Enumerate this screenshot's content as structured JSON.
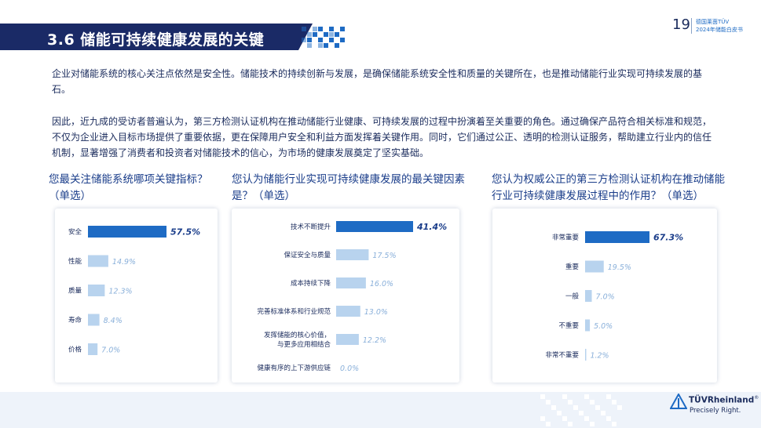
{
  "header": {
    "section_title": "3.6 储能可持续健康发展的关键",
    "page_number": "19",
    "brand_line1": "德国莱茵TÜV",
    "brand_line2": "2024年储能白皮书"
  },
  "body": {
    "paragraph1": "企业对储能系统的核心关注点依然是安全性。储能技术的持续创新与发展，是确保储能系统安全性和质量的关键所在，也是推动储能行业实现可持续发展的基石。",
    "paragraph2": "因此，近九成的受访者普遍认为，第三方检测认证机构在推动储能行业健康、可持续发展的过程中扮演着至关重要的角色。通过确保产品符合相关标准和规范，不仅为企业进入目标市场提供了重要依据，更在保障用户安全和利益方面发挥着关键作用。同时，它们通过公正、透明的检测认证服务，帮助建立行业内的信任机制，显著增强了消费者和投资者对储能技术的信心，为市场的健康发展奠定了坚实基础。"
  },
  "questions": {
    "q1": "您最关注储能系统哪项关键指标？（单选）",
    "q2": "您认为储能行业实现可持续健康发展的最关键因素是？（单选）",
    "q3": "您认为权威公正的第三方检测认证机构在推动储能行业可持续健康发展过程中的作用？（单选）"
  },
  "colors": {
    "highlight": "#1e6bc4",
    "bar": "#b8d3ee",
    "header": "#1a2a66",
    "value_highlight": "#1a3d8a",
    "value_normal": "#8ab0da"
  },
  "chart_data": [
    {
      "type": "bar",
      "orientation": "horizontal",
      "categories": [
        "安全",
        "性能",
        "质量",
        "寿命",
        "价格"
      ],
      "values": [
        57.5,
        14.9,
        12.3,
        8.4,
        7.0
      ],
      "value_labels": [
        "57.5%",
        "14.9%",
        "12.3%",
        "8.4%",
        "7.0%"
      ],
      "highlight_index": 0,
      "xlim": [
        0,
        57.5
      ]
    },
    {
      "type": "bar",
      "orientation": "horizontal",
      "categories": [
        "技术不断提升",
        "保证安全与质量",
        "成本持续下降",
        "完善标准体系和行业规范",
        "发挥储能的核心价值，与更多应用相结合",
        "健康有序的上下游供应链"
      ],
      "category_lines": [
        [
          "技术不断提升"
        ],
        [
          "保证安全与质量"
        ],
        [
          "成本持续下降"
        ],
        [
          "完善标准体系和行业规范"
        ],
        [
          "发挥储能的核心价值，",
          "与更多应用相结合"
        ],
        [
          "健康有序的上下游供应链"
        ]
      ],
      "values": [
        41.4,
        17.5,
        16.0,
        13.0,
        12.2,
        0.0
      ],
      "value_labels": [
        "41.4%",
        "17.5%",
        "16.0%",
        "13.0%",
        "12.2%",
        "0.0%"
      ],
      "highlight_index": 0,
      "xlim": [
        0,
        41.4
      ]
    },
    {
      "type": "bar",
      "orientation": "horizontal",
      "categories": [
        "非常重要",
        "重要",
        "一般",
        "不重要",
        "非常不重要"
      ],
      "values": [
        67.3,
        19.5,
        7.0,
        5.0,
        1.2
      ],
      "value_labels": [
        "67.3%",
        "19.5%",
        "7.0%",
        "5.0%",
        "1.2%"
      ],
      "highlight_index": 0,
      "xlim": [
        0,
        67.3
      ]
    }
  ],
  "footer": {
    "logo_text": "TÜVRheinland",
    "logo_registered": "®",
    "tagline": "Precisely Right."
  }
}
